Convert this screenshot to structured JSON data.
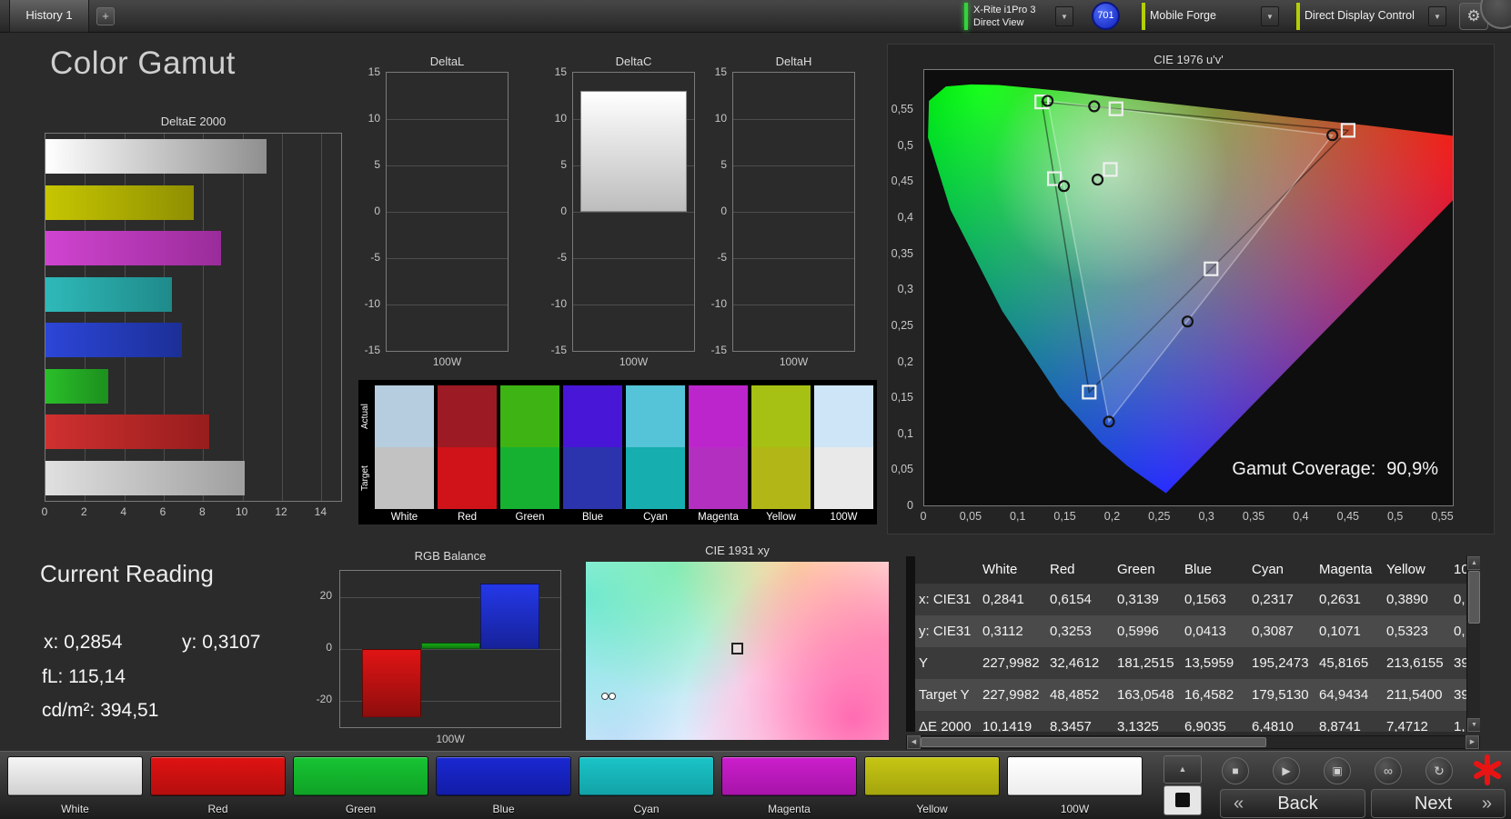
{
  "icons": {
    "plus": "+",
    "chevron_down": "▼",
    "gear": "⚙",
    "up_arrow": "▲",
    "down_arrow": "▼",
    "left_arrow": "◀",
    "right_arrow": "▶",
    "stop": "■",
    "play": "▶",
    "patch_window": "▣",
    "continuous": "∞",
    "loop": "↻",
    "back_chevrons": "«",
    "next_chevrons": "»"
  },
  "top_bar": {
    "tab_label": "History 1",
    "meter_line1": "X-Rite i1Pro 3",
    "meter_line2": "Direct View",
    "badge": "701",
    "workflow_label": "Mobile Forge",
    "display_label": "Direct Display Control"
  },
  "page_title": "Color Gamut",
  "deltae_chart": {
    "title": "DeltaE 2000",
    "xticks": [
      "0",
      "2",
      "4",
      "6",
      "8",
      "10",
      "12",
      "14"
    ],
    "xmax": 15,
    "bars": [
      {
        "name": "White",
        "value": 11.2,
        "c1": "#ffffff",
        "c2": "#8f8f8f"
      },
      {
        "name": "Yellow",
        "value": 7.5,
        "c1": "#c6c602",
        "c2": "#8f8f02"
      },
      {
        "name": "Magenta",
        "value": 8.9,
        "c1": "#d044d0",
        "c2": "#9a2c9a"
      },
      {
        "name": "Cyan",
        "value": 6.4,
        "c1": "#2fb9b9",
        "c2": "#1f8a8a"
      },
      {
        "name": "Blue",
        "value": 6.9,
        "c1": "#2c46d8",
        "c2": "#1c2f97"
      },
      {
        "name": "Green",
        "value": 3.2,
        "c1": "#2abf2a",
        "c2": "#1d8f1d"
      },
      {
        "name": "Red",
        "value": 8.3,
        "c1": "#d03030",
        "c2": "#971d1d"
      },
      {
        "name": "100W",
        "value": 10.1,
        "c1": "#e0e0e0",
        "c2": "#9f9f9f"
      }
    ]
  },
  "delta_small_charts": {
    "yticks": [
      "15",
      "10",
      "5",
      "0",
      "-5",
      "-10",
      "-15"
    ],
    "ymax": 15,
    "xlabel": "100W",
    "charts": [
      {
        "title": "DeltaL",
        "value": 0
      },
      {
        "title": "DeltaC",
        "value": 13
      },
      {
        "title": "DeltaH",
        "value": 0
      }
    ]
  },
  "swatch_panel": {
    "row_labels": [
      "Actual",
      "Target"
    ],
    "items": [
      {
        "name": "White",
        "actual": "#b5cddf",
        "target": "#c2c2c2"
      },
      {
        "name": "Red",
        "actual": "#9c1a24",
        "target": "#cf1318"
      },
      {
        "name": "Green",
        "actual": "#3eb414",
        "target": "#17b131"
      },
      {
        "name": "Blue",
        "actual": "#4716d6",
        "target": "#2b33ad"
      },
      {
        "name": "Cyan",
        "actual": "#55c4d8",
        "target": "#16aeae"
      },
      {
        "name": "Magenta",
        "actual": "#bd25cc",
        "target": "#b32fc0"
      },
      {
        "name": "Yellow",
        "actual": "#a6c113",
        "target": "#b2b616"
      },
      {
        "name": "100W",
        "actual": "#cde5f6",
        "target": "#e9e9e9"
      }
    ]
  },
  "cie1976": {
    "title": "CIE 1976 u'v'",
    "xticks": [
      "0",
      "0,05",
      "0,1",
      "0,15",
      "0,2",
      "0,25",
      "0,3",
      "0,35",
      "0,4",
      "0,45",
      "0,5",
      "0,55"
    ],
    "yticks": [
      "0",
      "0,05",
      "0,1",
      "0,15",
      "0,2",
      "0,25",
      "0,3",
      "0,35",
      "0,4",
      "0,45",
      "0,5",
      "0,55"
    ],
    "umax": 0.562,
    "vmax": 0.607,
    "gamut_coverage_label": "Gamut Coverage:",
    "gamut_coverage_value": "90,9%",
    "target_points": [
      [
        0.4507,
        0.5229
      ],
      [
        0.125,
        0.5625
      ],
      [
        0.1754,
        0.1579
      ],
      [
        0.1978,
        0.4683
      ],
      [
        0.1384,
        0.4555
      ],
      [
        0.305,
        0.3298
      ],
      [
        0.2039,
        0.5529
      ]
    ],
    "measured_points": [
      [
        0.434,
        0.5161
      ],
      [
        0.1312,
        0.564
      ],
      [
        0.1964,
        0.1168
      ],
      [
        0.1843,
        0.4542
      ],
      [
        0.1485,
        0.4452
      ],
      [
        0.28,
        0.2564
      ],
      [
        0.1807,
        0.5564
      ]
    ],
    "target_triangle": [
      [
        0.4507,
        0.5229
      ],
      [
        0.125,
        0.5625
      ],
      [
        0.1754,
        0.1579
      ]
    ],
    "measured_triangle": [
      [
        0.434,
        0.5161
      ],
      [
        0.1312,
        0.564
      ],
      [
        0.1964,
        0.1168
      ]
    ]
  },
  "current_reading": {
    "title": "Current Reading",
    "x_label": "x:",
    "x_value": "0,2854",
    "y_label": "y:",
    "y_value": "0,3107",
    "fl_label": "fL:",
    "fl_value": "115,14",
    "cd_label": "cd/m²:",
    "cd_value": "394,51"
  },
  "rgb_balance": {
    "title": "RGB Balance",
    "yticks": [
      "20",
      "0",
      "-20"
    ],
    "ymax": 30,
    "xlabel": "100W",
    "bars": [
      {
        "name": "red",
        "value": -26,
        "c1": "#e01414",
        "c2": "#8f0d0d"
      },
      {
        "name": "green",
        "value": 2.5,
        "c1": "#17a817",
        "c2": "#0f7a0f"
      },
      {
        "name": "blue",
        "value": 25,
        "c1": "#2438e8",
        "c2": "#16229a"
      }
    ]
  },
  "cie1931": {
    "title": "CIE 1931 xy"
  },
  "results_table": {
    "columns": [
      "White",
      "Red",
      "Green",
      "Blue",
      "Cyan",
      "Magenta",
      "Yellow",
      "10"
    ],
    "rows": [
      {
        "label": "x: CIE31",
        "values": [
          "0,2841",
          "0,6154",
          "0,3139",
          "0,1563",
          "0,2317",
          "0,2631",
          "0,3890",
          "0,"
        ]
      },
      {
        "label": "y: CIE31",
        "values": [
          "0,3112",
          "0,3253",
          "0,5996",
          "0,0413",
          "0,3087",
          "0,1071",
          "0,5323",
          "0,"
        ]
      },
      {
        "label": "Y",
        "values": [
          "227,9982",
          "32,4612",
          "181,2515",
          "13,5959",
          "195,2473",
          "45,8165",
          "213,6155",
          "39"
        ]
      },
      {
        "label": "Target Y",
        "values": [
          "227,9982",
          "48,4852",
          "163,0548",
          "16,4582",
          "179,5130",
          "64,9434",
          "211,5400",
          "39"
        ]
      },
      {
        "label": "ΔE 2000",
        "values": [
          "10,1419",
          "8,3457",
          "3,1325",
          "6,9035",
          "6,4810",
          "8,8741",
          "7,4712",
          "1,"
        ]
      }
    ]
  },
  "bottom_bar": {
    "patches": [
      {
        "name": "White",
        "c1": "#f5f5f5",
        "c2": "#d0d0d0"
      },
      {
        "name": "Red",
        "c1": "#e01212",
        "c2": "#b40e0e"
      },
      {
        "name": "Green",
        "c1": "#17c433",
        "c2": "#0fa226"
      },
      {
        "name": "Blue",
        "c1": "#1a28d2",
        "c2": "#121ca6"
      },
      {
        "name": "Cyan",
        "c1": "#1ac4c8",
        "c2": "#12a2a6"
      },
      {
        "name": "Magenta",
        "c1": "#cc1ecc",
        "c2": "#a614a8"
      },
      {
        "name": "Yellow",
        "c1": "#c6c614",
        "c2": "#a4a40e"
      },
      {
        "name": "100W",
        "c1": "#ffffff",
        "c2": "#ececec"
      }
    ],
    "back_label": "Back",
    "next_label": "Next"
  }
}
